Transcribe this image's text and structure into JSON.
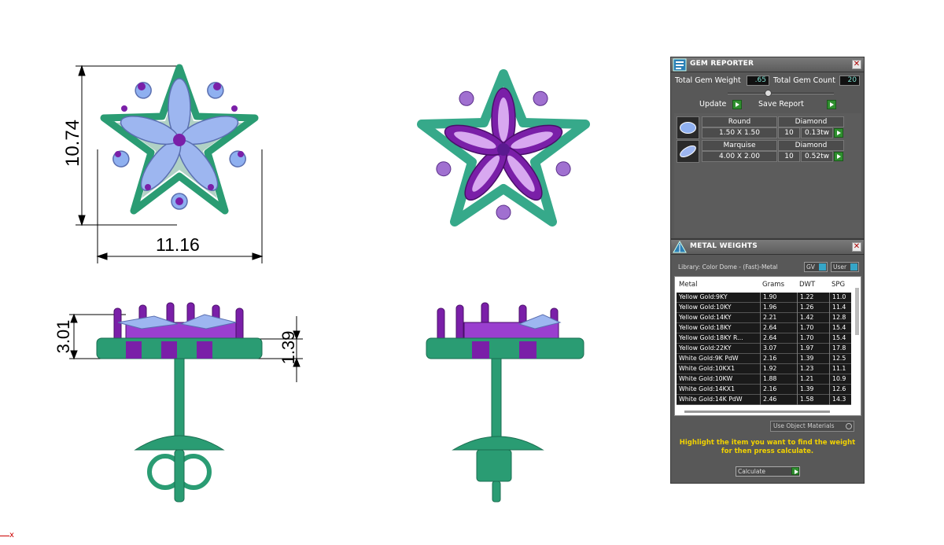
{
  "dimensions": {
    "height_label": "10.74",
    "width_label": "11.16",
    "top_height_label": "3.01",
    "setting_height_label": "1.39"
  },
  "viewport": {
    "axis_marker": "x"
  },
  "colors": {
    "metal": "#2a9c73",
    "metal_dark": "#1a6e50",
    "gem_marquise": "#9db6f0",
    "gem_round": "#8fb0f0",
    "prong": "#7a1fa8",
    "panel_bg": "#585858",
    "highlight_text": "#f2d200"
  },
  "gem_reporter": {
    "title": "GEM REPORTER",
    "close_icon": "close-icon",
    "total_gem_weight_label": "Total Gem Weight",
    "total_gem_weight_value": ".65",
    "total_gem_count_label": "Total Gem Count",
    "total_gem_count_value": "20",
    "update_label": "Update",
    "save_report_label": "Save Report",
    "gems": [
      {
        "shape": "Round",
        "size": "1.50 X 1.50",
        "material": "Diamond",
        "count": "10",
        "weight": "0.13tw"
      },
      {
        "shape": "Marquise",
        "size": "4.00 X 2.00",
        "material": "Diamond",
        "count": "10",
        "weight": "0.52tw"
      }
    ]
  },
  "metal_weights": {
    "title": "METAL WEIGHTS",
    "library": "Library: Color Dome - (Fast)-Metal",
    "sel_gv": "GV",
    "sel_user": "User",
    "columns": [
      "Metal",
      "Grams",
      "DWT",
      "SPG"
    ],
    "rows": [
      [
        "Yellow Gold:9KY",
        "1.90",
        "1.22",
        "11.0"
      ],
      [
        "Yellow Gold:10KY",
        "1.96",
        "1.26",
        "11.4"
      ],
      [
        "Yellow Gold:14KY",
        "2.21",
        "1.42",
        "12.8"
      ],
      [
        "Yellow Gold:18KY",
        "2.64",
        "1.70",
        "15.4"
      ],
      [
        "Yellow Gold:18KY R...",
        "2.64",
        "1.70",
        "15.4"
      ],
      [
        "Yellow Gold:22KY",
        "3.07",
        "1.97",
        "17.8"
      ],
      [
        "White Gold:9K PdW",
        "2.16",
        "1.39",
        "12.5"
      ],
      [
        "White Gold:10KX1",
        "1.92",
        "1.23",
        "11.1"
      ],
      [
        "White Gold:10KW",
        "1.88",
        "1.21",
        "10.9"
      ],
      [
        "White Gold:14KX1",
        "2.16",
        "1.39",
        "12.6"
      ],
      [
        "White Gold:14K PdW",
        "2.46",
        "1.58",
        "14.3"
      ]
    ],
    "use_object_materials": "Use Object Materials",
    "hint": "Highlight the item you want to find the weight for then press calculate.",
    "calculate_label": "Calculate"
  }
}
